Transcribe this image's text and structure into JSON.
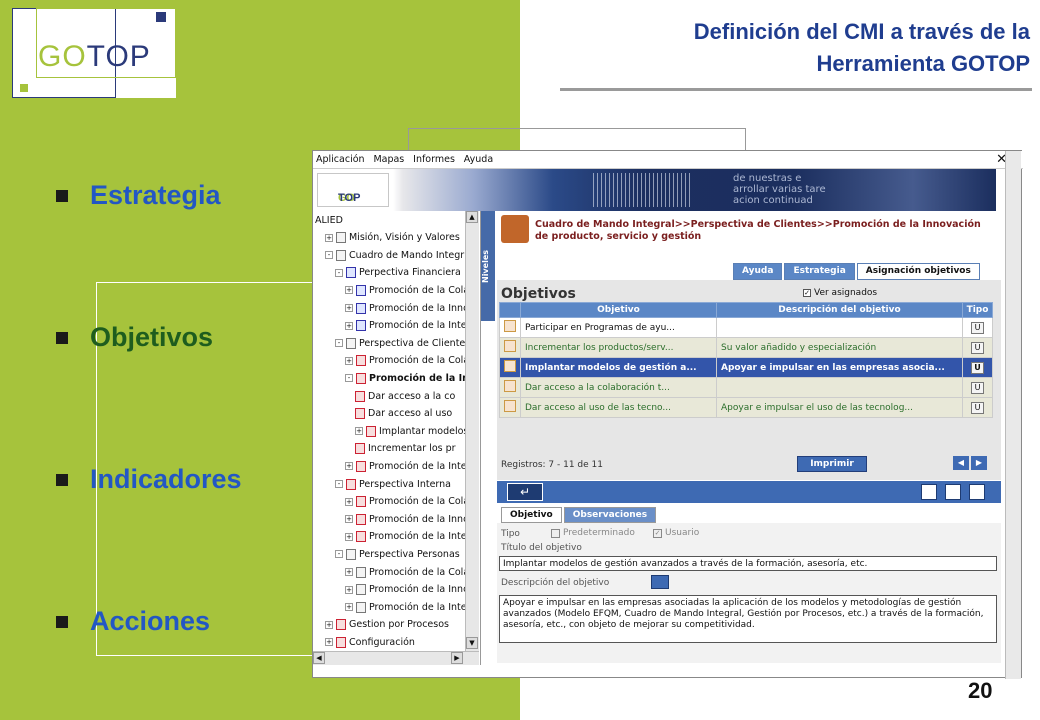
{
  "slide": {
    "title_line1": "Definición del CMI a través de la",
    "title_line2": "Herramienta GOTOP",
    "logo_go": "GO",
    "logo_top": "TOP",
    "bullets": [
      "Estrategia",
      "Objetivos",
      "Indicadores",
      "Acciones"
    ],
    "page_number": "20"
  },
  "app": {
    "menu": [
      "Aplicación",
      "Mapas",
      "Informes",
      "Ayuda"
    ],
    "close": "✕",
    "banner_logo_go": "GO",
    "banner_logo_top": "TOP",
    "banner_text": [
      "de nuestras e",
      "arrollar varias tare",
      "acion continuad"
    ],
    "tree": [
      {
        "label": "ALIED",
        "level": 0,
        "pm": "",
        "icon": ""
      },
      {
        "label": "Misión, Visión y Valores",
        "level": 1,
        "pm": "+",
        "icon": "doc"
      },
      {
        "label": "Cuadro de Mando Integr",
        "level": 1,
        "pm": "-",
        "icon": "doc"
      },
      {
        "label": "Perpectiva Financiera",
        "level": 2,
        "pm": "-",
        "icon": "blue"
      },
      {
        "label": "Promoción de la Cola",
        "level": 3,
        "pm": "+",
        "icon": "blue"
      },
      {
        "label": "Promoción de la Inno",
        "level": 3,
        "pm": "+",
        "icon": "blue"
      },
      {
        "label": "Promoción de la Inte",
        "level": 3,
        "pm": "+",
        "icon": "blue"
      },
      {
        "label": "Perspectiva de Cliente",
        "level": 2,
        "pm": "-",
        "icon": "doc"
      },
      {
        "label": "Promoción de la Cola",
        "level": 3,
        "pm": "+",
        "icon": "red"
      },
      {
        "label": "Promoción de la In",
        "level": 3,
        "pm": "-",
        "icon": "red",
        "bold": true
      },
      {
        "label": "Dar acceso a la co",
        "level": 4,
        "pm": "",
        "icon": "red"
      },
      {
        "label": "Dar acceso al uso",
        "level": 4,
        "pm": "",
        "icon": "red"
      },
      {
        "label": "Implantar modelos",
        "level": 4,
        "pm": "+",
        "icon": "red"
      },
      {
        "label": "Incrementar los pr",
        "level": 4,
        "pm": "",
        "icon": "red"
      },
      {
        "label": "Promoción de la Inte",
        "level": 3,
        "pm": "+",
        "icon": "red"
      },
      {
        "label": "Perspectiva Interna",
        "level": 2,
        "pm": "-",
        "icon": "red"
      },
      {
        "label": "Promoción de la Cola",
        "level": 3,
        "pm": "+",
        "icon": "red"
      },
      {
        "label": "Promoción de la Inno",
        "level": 3,
        "pm": "+",
        "icon": "red"
      },
      {
        "label": "Promoción de la Inte",
        "level": 3,
        "pm": "+",
        "icon": "red"
      },
      {
        "label": "Perspectiva Personas",
        "level": 2,
        "pm": "-",
        "icon": "doc"
      },
      {
        "label": "Promoción de la Cola",
        "level": 3,
        "pm": "+",
        "icon": "doc"
      },
      {
        "label": "Promoción de la Inno",
        "level": 3,
        "pm": "+",
        "icon": "doc"
      },
      {
        "label": "Promoción de la Inte",
        "level": 3,
        "pm": "+",
        "icon": "doc"
      },
      {
        "label": "Gestion por Procesos",
        "level": 1,
        "pm": "+",
        "icon": "red"
      },
      {
        "label": "Configuración",
        "level": 1,
        "pm": "+",
        "icon": "red"
      }
    ],
    "niveles": "Niveles",
    "breadcrumb": "Cuadro de Mando Integral>>Perspectiva de Clientes>>Promoción de la Innovación de producto, servicio y gestión",
    "tabs": [
      "Ayuda",
      "Estrategia",
      "Asignación objetivos"
    ],
    "panel_title": "Objetivos",
    "ver_asignados": "Ver asignados",
    "table": {
      "headers": [
        "Objetivo",
        "Descripción del objetivo",
        "Tipo"
      ],
      "rows": [
        {
          "objetivo": "Participar en Programas de ayu...",
          "descripcion": "",
          "tipo": "U",
          "style": "w"
        },
        {
          "objetivo": "Incrementar los productos/serv...",
          "descripcion": "Su valor añadido y especialización",
          "tipo": "U",
          "style": "g"
        },
        {
          "objetivo": "Implantar modelos de gestión a...",
          "descripcion": "Apoyar e impulsar en las empresas asocia...",
          "tipo": "U",
          "style": "sel"
        },
        {
          "objetivo": "Dar acceso a la colaboración t...",
          "descripcion": "",
          "tipo": "U",
          "style": "g"
        },
        {
          "objetivo": "Dar acceso al uso de las tecno...",
          "descripcion": "Apoyar e impulsar el uso de las tecnolog...",
          "tipo": "U",
          "style": "g"
        }
      ]
    },
    "registros": "Registros: 7 - 11 de 11",
    "imprimir": "Imprimir",
    "bottom_tabs": [
      "Objetivo",
      "Observaciones"
    ],
    "form": {
      "tipo_label": "Tipo",
      "predeterminado": "Predeterminado",
      "usuario": "Usuario",
      "titulo_label": "Título del objetivo",
      "titulo_value": "Implantar modelos de gestión avanzados a través de la formación, asesoría, etc.",
      "descripcion_label": "Descripción del objetivo",
      "descripcion_value": "Apoyar e impulsar en las empresas asociadas la aplicación de los modelos y metodologías de gestión avanzados (Modelo EFQM, Cuadro de Mando Integral, Gestión por Procesos, etc.) a través de la formación, asesoría, etc., con objeto de mejorar su competitividad."
    }
  }
}
